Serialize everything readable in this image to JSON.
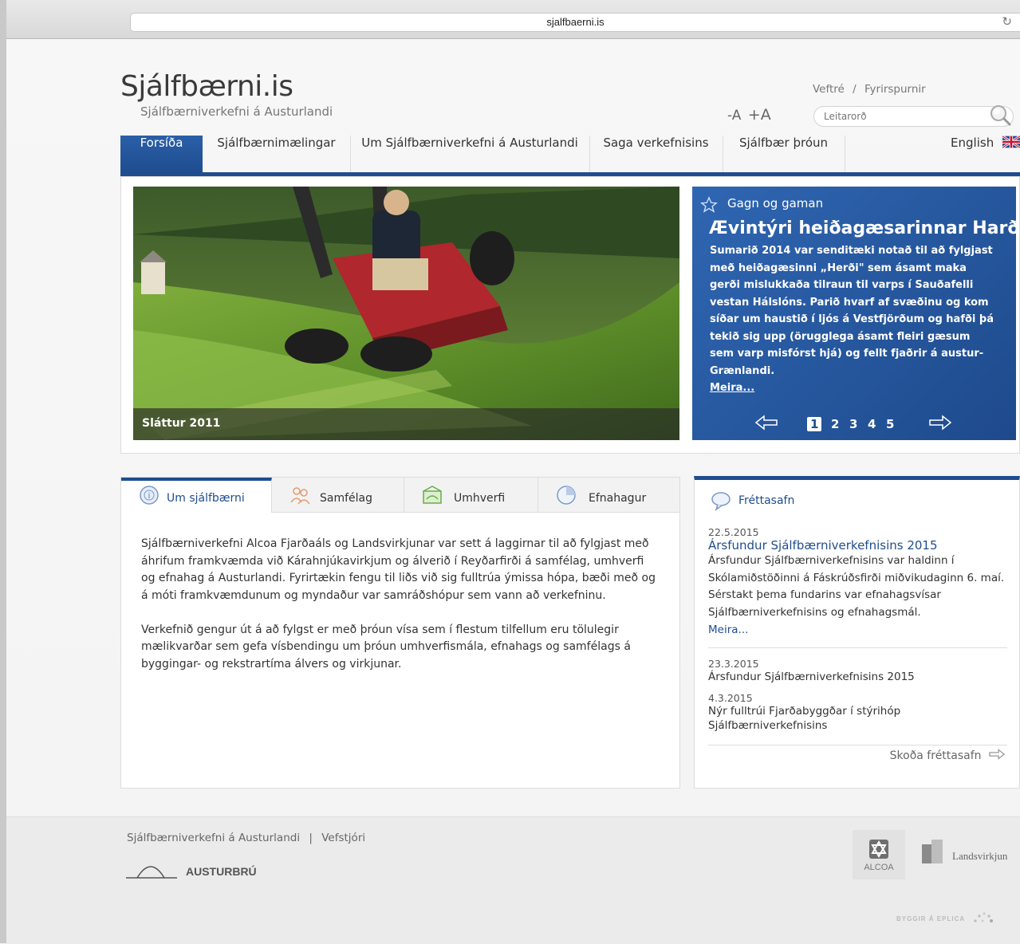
{
  "browser": {
    "url": "sjalfbaerni.is"
  },
  "header": {
    "title": "Sjálfbærni.is",
    "subtitle": "Sjálfbærniverkefni á Austurlandi",
    "toplinks": {
      "sitemap": "Veftré",
      "separator": "/",
      "inquiries": "Fyrirspurnir"
    },
    "font_smaller": "-A",
    "font_larger": "+A",
    "search_placeholder": "Leitarorð"
  },
  "nav": {
    "items": [
      {
        "label": "Forsíða",
        "active": true
      },
      {
        "label": "Sjálfbærnimælingar"
      },
      {
        "label": "Um Sjálfbærniverkefni á Austurlandi"
      },
      {
        "label": "Saga verkefnisins"
      },
      {
        "label": "Sjálfbær þróun"
      }
    ],
    "language": "English"
  },
  "slider": {
    "caption": "Sláttur 2011",
    "category": "Gagn og gaman",
    "title": "Ævintýri heiðagæsarinnar Harðar",
    "body": "Sumarið 2014 var senditæki notað til að  fylgjast með heiðagæsinni „Herði\" sem ásamt maka gerði mislukkaða tilraun til varps í Sauðafelli vestan Hálslóns. Parið hvarf af svæðinu og kom síðar um haustið í ljós á Vestfjörðum og hafði þá tekið sig upp (örugglega ásamt fleiri gæsum sem varp misfórst hjá) og fellt fjaðrir á austur-Grænlandi.",
    "more": "Meira...",
    "pages": [
      "1",
      "2",
      "3",
      "4",
      "5"
    ],
    "current_page": "1"
  },
  "tabs": {
    "items": [
      {
        "label": "Um sjálfbærni",
        "icon": "info-icon",
        "active": true
      },
      {
        "label": "Samfélag",
        "icon": "people-icon"
      },
      {
        "label": "Umhverfi",
        "icon": "environment-icon"
      },
      {
        "label": "Efnahagur",
        "icon": "economy-icon"
      }
    ],
    "paragraphs": [
      "Sjálfbærniverkefni Alcoa Fjarðaáls og Landsvirkjunar var sett á laggirnar til að fylgjast með áhrifum framkvæmda við Kárahnjúkavirkjum og álverið í Reyðarfirði á samfélag, umhverfi og efnahag á Austurlandi. Fyrirtækin fengu til liðs við sig fulltrúa ýmissa hópa, bæði með og á móti framkvæmdunum og myndaður var samráðshópur sem vann að verkefninu.",
      "Verkefnið gengur út á að fylgst er með þróun vísa sem í flestum tilfellum eru tölulegir mælikvarðar sem gefa vísbendingu um þróun umhverfismála, efnahags og samfélags á byggingar- og rekstrartíma álvers og virkjunar."
    ]
  },
  "news": {
    "heading": "Fréttasafn",
    "featured": {
      "date": "22.5.2015",
      "title": "Ársfundur Sjálfbærniverkefnisins 2015",
      "text": "Ársfundur Sjálfbærniverkefnisins var haldinn í Skólamiðstöðinni á Fáskrúðsfirði miðvikudaginn 6. maí.  Sérstakt þema fundarins var efnahagsvísar Sjálfbærniverkefnisins og efnahagsmál.",
      "more": "Meira..."
    },
    "items": [
      {
        "date": "23.3.2015",
        "title": "Ársfundur Sjálfbærniverkefnisins 2015"
      },
      {
        "date": "4.3.2015",
        "title": "Nýr fulltrúi Fjarðabyggðar í stýrihóp Sjálfbærniverkefnisins"
      }
    ],
    "archive_link": "Skoða fréttasafn"
  },
  "footer": {
    "link1": "Sjálfbærniverkefni á Austurlandi",
    "separator": "|",
    "link2": "Vefstjóri",
    "partner1": "AUSTURBRÚ",
    "partner2": "ALCOA",
    "partner3": "Landsvirkjun",
    "credit": "BYGGIR Á EPLICA"
  },
  "colors": {
    "brand_blue": "#1f4d8f",
    "slider_blue": "#2f66b2"
  }
}
